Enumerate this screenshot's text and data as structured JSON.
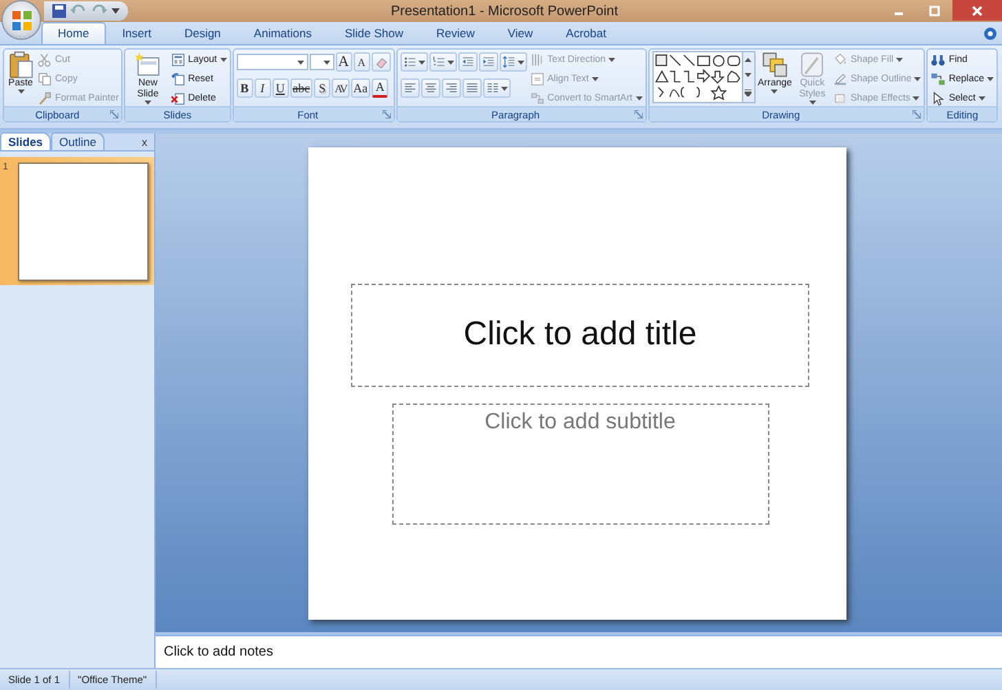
{
  "window": {
    "title": "Presentation1 - Microsoft PowerPoint"
  },
  "tabs": [
    {
      "label": "Home",
      "selected": true
    },
    {
      "label": "Insert",
      "selected": false
    },
    {
      "label": "Design",
      "selected": false
    },
    {
      "label": "Animations",
      "selected": false
    },
    {
      "label": "Slide Show",
      "selected": false
    },
    {
      "label": "Review",
      "selected": false
    },
    {
      "label": "View",
      "selected": false
    },
    {
      "label": "Acrobat",
      "selected": false
    }
  ],
  "ribbon": {
    "groups": [
      {
        "label": "Clipboard",
        "launcher": true,
        "items": [
          {
            "kind": "large",
            "label": "Paste",
            "dropdown": true,
            "disabled": false
          },
          {
            "kind": "stack",
            "items": [
              {
                "label": "Cut",
                "dropdown": false,
                "disabled": true
              },
              {
                "label": "Copy",
                "dropdown": false,
                "disabled": true
              },
              {
                "label": "Format Painter",
                "dropdown": false,
                "disabled": true
              }
            ]
          }
        ]
      },
      {
        "label": "Slides",
        "launcher": false,
        "items": [
          {
            "kind": "large",
            "label": "New Slide",
            "dropdown": true,
            "disabled": false
          },
          {
            "kind": "stack",
            "items": [
              {
                "label": "Layout",
                "dropdown": true,
                "disabled": false
              },
              {
                "label": "Reset",
                "dropdown": false,
                "disabled": false
              },
              {
                "label": "Delete",
                "dropdown": false,
                "disabled": false
              }
            ]
          }
        ]
      },
      {
        "label": "Font",
        "launcher": true,
        "items": [
          {
            "kind": "rows",
            "rows": [
              {
                "items": [
                  {
                    "kind": "field"
                  },
                  {
                    "kind": "field"
                  },
                  {
                    "kind": "glyph",
                    "text": "A"
                  },
                  {
                    "kind": "glyph",
                    "text": "A"
                  },
                  {
                    "kind": "tool",
                    "dropdown": false
                  }
                ]
              },
              {
                "items": [
                  {
                    "kind": "glyph",
                    "text": "B"
                  },
                  {
                    "kind": "glyph",
                    "text": "I"
                  },
                  {
                    "kind": "glyph",
                    "text": "U"
                  },
                  {
                    "kind": "glyph",
                    "text": "abc"
                  },
                  {
                    "kind": "glyph",
                    "text": "S"
                  },
                  {
                    "kind": "glyph",
                    "text": "AV"
                  },
                  {
                    "kind": "glyph",
                    "text": "Aa"
                  },
                  {
                    "kind": "glyph",
                    "text": "A"
                  }
                ]
              }
            ]
          }
        ]
      },
      {
        "label": "Paragraph",
        "launcher": true,
        "items": [
          {
            "kind": "rows",
            "rows": [
              {
                "items": [
                  {
                    "kind": "tool",
                    "dropdown": true
                  },
                  {
                    "kind": "tool",
                    "dropdown": true
                  },
                  {
                    "kind": "tool",
                    "dropdown": false
                  },
                  {
                    "kind": "tool",
                    "dropdown": false
                  },
                  {
                    "kind": "tool",
                    "dropdown": true
                  }
                ]
              },
              {
                "items": [
                  {
                    "kind": "tool",
                    "dropdown": false
                  },
                  {
                    "kind": "tool",
                    "dropdown": false
                  },
                  {
                    "kind": "tool",
                    "dropdown": false
                  },
                  {
                    "kind": "tool",
                    "dropdown": false
                  },
                  {
                    "kind": "tool",
                    "dropdown": true
                  }
                ]
              }
            ]
          },
          {
            "kind": "stack",
            "items": [
              {
                "label": "Text Direction",
                "dropdown": true,
                "disabled": true
              },
              {
                "label": "Align Text",
                "dropdown": true,
                "disabled": true
              },
              {
                "label": "Convert to SmartArt",
                "dropdown": true,
                "disabled": true
              }
            ]
          }
        ]
      },
      {
        "label": "Drawing",
        "launcher": true,
        "items": [
          {
            "kind": "gallery"
          },
          {
            "kind": "large",
            "label": "Arrange",
            "dropdown": true,
            "disabled": false
          },
          {
            "kind": "large",
            "label": "Quick Styles",
            "dropdown": true,
            "disabled": true
          },
          {
            "kind": "stack",
            "items": [
              {
                "label": "Shape Fill",
                "dropdown": true,
                "disabled": true
              },
              {
                "label": "Shape Outline",
                "dropdown": true,
                "disabled": true
              },
              {
                "label": "Shape Effects",
                "dropdown": true,
                "disabled": true
              }
            ]
          }
        ]
      },
      {
        "label": "Editing",
        "launcher": false,
        "items": [
          {
            "kind": "stack",
            "items": [
              {
                "label": "Find",
                "dropdown": false,
                "disabled": false
              },
              {
                "label": "Replace",
                "dropdown": true,
                "disabled": false
              },
              {
                "label": "Select",
                "dropdown": true,
                "disabled": false
              }
            ]
          }
        ]
      }
    ]
  },
  "slides_pane": {
    "tabs": [
      {
        "label": "Slides",
        "selected": true
      },
      {
        "label": "Outline",
        "selected": false
      }
    ],
    "close": "x",
    "thumbnails": [
      {
        "number": "1",
        "selected": true
      }
    ]
  },
  "slide": {
    "title_placeholder": "Click to add title",
    "subtitle_placeholder": "Click to add subtitle"
  },
  "notes": {
    "placeholder": "Click to add notes"
  },
  "status_bar": [
    "Slide 1 of 1",
    "\"Office Theme\""
  ]
}
